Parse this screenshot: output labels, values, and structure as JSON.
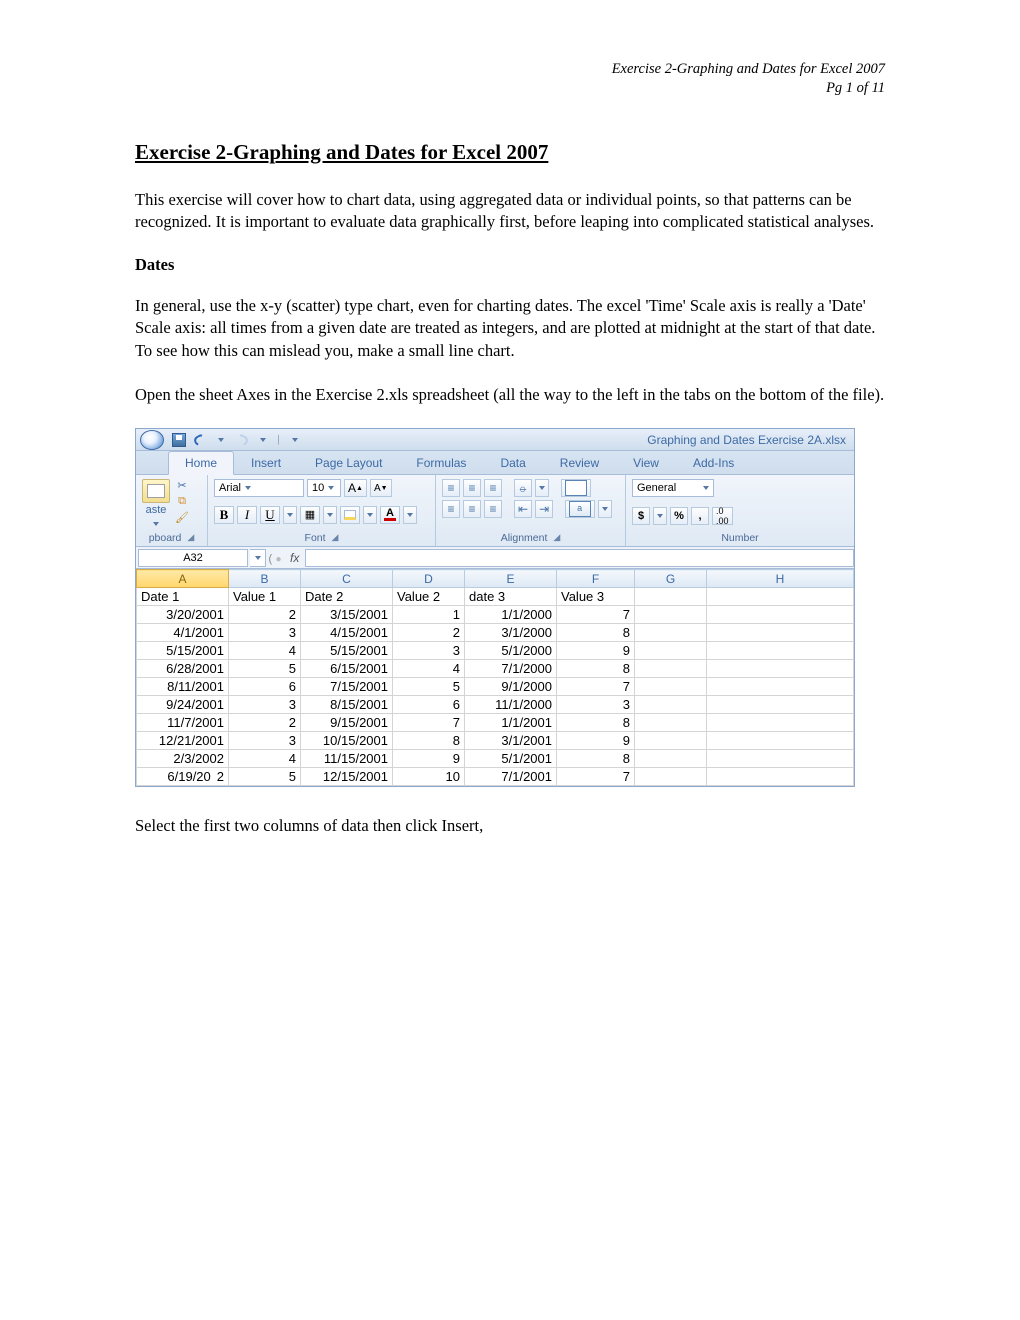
{
  "header": {
    "line1": "Exercise 2-Graphing and Dates for Excel 2007",
    "line2": "Pg 1 of 11"
  },
  "title": "Exercise 2-Graphing and Dates for Excel 2007",
  "paragraphs": {
    "p1": "This exercise will cover how to chart data, using aggregated data or individual points, so that patterns can be recognized.  It is important to evaluate data graphically first, before leaping into complicated statistical analyses.",
    "sub1": "Dates",
    "p2": "In general, use the x-y (scatter) type chart, even for charting dates.  The excel 'Time' Scale axis is really a 'Date' Scale axis: all times from a given date are treated as integers, and are plotted at midnight at the start of that date.  To see how this can mislead you, make a small line chart.",
    "p3": "Open the sheet Axes in the Exercise 2.xls spreadsheet (all the way to the left in the tabs on the bottom of the file).",
    "p4": "Select the first two columns of data then click Insert,"
  },
  "excel": {
    "window_title": "Graphing and Dates Exercise 2A.xlsx",
    "tabs": [
      "Home",
      "Insert",
      "Page Layout",
      "Formulas",
      "Data",
      "Review",
      "View",
      "Add-Ins"
    ],
    "groups": {
      "clipboard": "pboard",
      "font": "Font",
      "alignment": "Alignment",
      "number": "Number"
    },
    "paste_label": "aste",
    "font_name": "Arial",
    "font_size": "10",
    "number_format": "General",
    "name_box": "A32",
    "fx_label": "fx",
    "col_headers": [
      "A",
      "B",
      "C",
      "D",
      "E",
      "F",
      "G",
      "H"
    ],
    "data_headers": [
      "Date 1",
      "Value 1",
      "Date 2",
      "Value 2",
      "date 3",
      "Value 3"
    ],
    "rows": [
      [
        "3/20/2001",
        "2",
        "3/15/2001",
        "1",
        "1/1/2000",
        "7"
      ],
      [
        "4/1/2001",
        "3",
        "4/15/2001",
        "2",
        "3/1/2000",
        "8"
      ],
      [
        "5/15/2001",
        "4",
        "5/15/2001",
        "3",
        "5/1/2000",
        "9"
      ],
      [
        "6/28/2001",
        "5",
        "6/15/2001",
        "4",
        "7/1/2000",
        "8"
      ],
      [
        "8/11/2001",
        "6",
        "7/15/2001",
        "5",
        "9/1/2000",
        "7"
      ],
      [
        "9/24/2001",
        "3",
        "8/15/2001",
        "6",
        "11/1/2000",
        "3"
      ],
      [
        "11/7/2001",
        "2",
        "9/15/2001",
        "7",
        "1/1/2001",
        "8"
      ],
      [
        "12/21/2001",
        "3",
        "10/15/2001",
        "8",
        "3/1/2001",
        "9"
      ],
      [
        "2/3/2002",
        "4",
        "11/15/2001",
        "9",
        "5/1/2001",
        "8"
      ],
      [
        "6/19/20",
        "5",
        "12/15/2001",
        "10",
        "7/1/2001",
        "7"
      ]
    ],
    "last_row_partial_append": "2"
  }
}
